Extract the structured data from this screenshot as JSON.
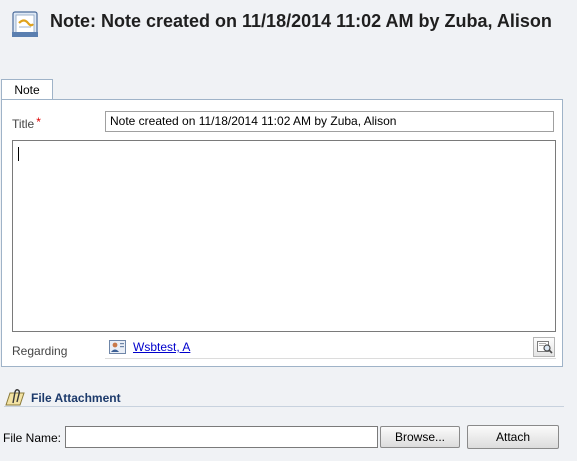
{
  "header": {
    "icon": "note-document-icon",
    "title": "Note: Note created on 11/18/2014 11:02 AM by Zuba, Alison"
  },
  "tabs": [
    {
      "label": "Note",
      "selected": true
    }
  ],
  "form": {
    "title_label": "Title",
    "required_marker": "*",
    "title_value": "Note created on 11/18/2014 11:02 AM by Zuba, Alison",
    "body_value": "",
    "regarding_label": "Regarding",
    "regarding": {
      "icon": "contact-card-icon",
      "value": "Wsbtest, A",
      "lookup_icon": "lookup-magnifier-icon"
    }
  },
  "attachment": {
    "section_icon": "paperclip-icon",
    "section_title": "File Attachment",
    "file_name_label": "File Name:",
    "file_name_value": "",
    "browse_label": "Browse...",
    "attach_label": "Attach"
  },
  "colors": {
    "background": "#f0f2f5",
    "panel_border": "#9fb3c8",
    "required": "#dd0000",
    "link": "#0000cc",
    "section_title": "#1c3a6b"
  }
}
